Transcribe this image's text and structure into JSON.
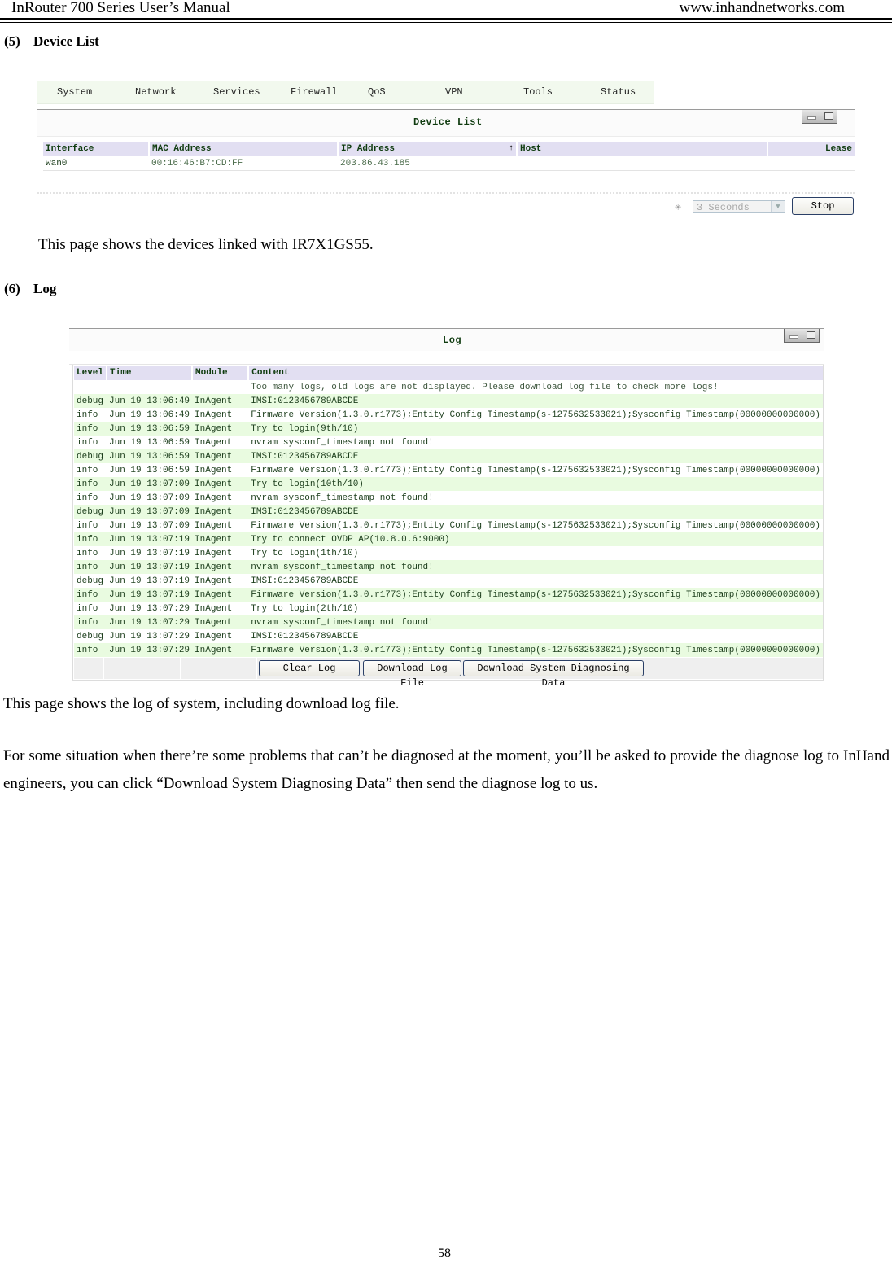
{
  "header": {
    "left": "InRouter 700 Series User’s Manual",
    "right": "www.inhandnetworks.com"
  },
  "sections": {
    "device_list": {
      "number": "(5)",
      "title": "Device List",
      "description": "This page shows the devices linked with IR7X1GS55."
    },
    "log": {
      "number": "(6)",
      "title": "Log",
      "description": "This page shows the log of system, including download log file.",
      "note": "For some situation when there’re some problems that can’t be diagnosed at the moment, you’ll be asked to provide the diagnose log to InHand engineers, you can click “Download System Diagnosing Data” then send the diagnose log to us."
    }
  },
  "device_list_ui": {
    "nav": [
      "System",
      "Network",
      "Services",
      "Firewall",
      "QoS",
      "VPN",
      "Tools",
      "Status"
    ],
    "panel_title": "Device List",
    "columns": [
      "Interface",
      "MAC Address",
      "IP Address",
      "Host",
      "Lease"
    ],
    "sort_indicator": "↑",
    "rows": [
      {
        "interface": "wan0",
        "mac": "00:16:46:B7:CD:FF",
        "ip": "203.86.43.185",
        "host": "",
        "lease": ""
      }
    ],
    "refresh_interval": "3 Seconds",
    "stop_label": "Stop",
    "spinner_glyph": "✳"
  },
  "log_ui": {
    "panel_title": "Log",
    "columns": [
      "Level",
      "Time",
      "Module",
      "Content"
    ],
    "notice": "Too many logs, old logs are not displayed. Please download log file to check more logs!",
    "rows": [
      {
        "level": "debug",
        "time": "Jun 19 13:06:49",
        "module": "InAgent",
        "content": "IMSI:0123456789ABCDE"
      },
      {
        "level": "info",
        "time": "Jun 19 13:06:49",
        "module": "InAgent",
        "content": "Firmware Version(1.3.0.r1773);Entity Config Timestamp(s-1275632533021);Sysconfig Timestamp(00000000000000)"
      },
      {
        "level": "info",
        "time": "Jun 19 13:06:59",
        "module": "InAgent",
        "content": "Try to login(9th/10)"
      },
      {
        "level": "info",
        "time": "Jun 19 13:06:59",
        "module": "InAgent",
        "content": "nvram sysconf_timestamp not found!"
      },
      {
        "level": "debug",
        "time": "Jun 19 13:06:59",
        "module": "InAgent",
        "content": "IMSI:0123456789ABCDE"
      },
      {
        "level": "info",
        "time": "Jun 19 13:06:59",
        "module": "InAgent",
        "content": "Firmware Version(1.3.0.r1773);Entity Config Timestamp(s-1275632533021);Sysconfig Timestamp(00000000000000)"
      },
      {
        "level": "info",
        "time": "Jun 19 13:07:09",
        "module": "InAgent",
        "content": "Try to login(10th/10)"
      },
      {
        "level": "info",
        "time": "Jun 19 13:07:09",
        "module": "InAgent",
        "content": "nvram sysconf_timestamp not found!"
      },
      {
        "level": "debug",
        "time": "Jun 19 13:07:09",
        "module": "InAgent",
        "content": "IMSI:0123456789ABCDE"
      },
      {
        "level": "info",
        "time": "Jun 19 13:07:09",
        "module": "InAgent",
        "content": "Firmware Version(1.3.0.r1773);Entity Config Timestamp(s-1275632533021);Sysconfig Timestamp(00000000000000)"
      },
      {
        "level": "info",
        "time": "Jun 19 13:07:19",
        "module": "InAgent",
        "content": "Try to connect OVDP AP(10.8.0.6:9000)"
      },
      {
        "level": "info",
        "time": "Jun 19 13:07:19",
        "module": "InAgent",
        "content": "Try to login(1th/10)"
      },
      {
        "level": "info",
        "time": "Jun 19 13:07:19",
        "module": "InAgent",
        "content": "nvram sysconf_timestamp not found!"
      },
      {
        "level": "debug",
        "time": "Jun 19 13:07:19",
        "module": "InAgent",
        "content": "IMSI:0123456789ABCDE"
      },
      {
        "level": "info",
        "time": "Jun 19 13:07:19",
        "module": "InAgent",
        "content": "Firmware Version(1.3.0.r1773);Entity Config Timestamp(s-1275632533021);Sysconfig Timestamp(00000000000000)"
      },
      {
        "level": "info",
        "time": "Jun 19 13:07:29",
        "module": "InAgent",
        "content": "Try to login(2th/10)"
      },
      {
        "level": "info",
        "time": "Jun 19 13:07:29",
        "module": "InAgent",
        "content": "nvram sysconf_timestamp not found!"
      },
      {
        "level": "debug",
        "time": "Jun 19 13:07:29",
        "module": "InAgent",
        "content": "IMSI:0123456789ABCDE"
      },
      {
        "level": "info",
        "time": "Jun 19 13:07:29",
        "module": "InAgent",
        "content": "Firmware Version(1.3.0.r1773);Entity Config Timestamp(s-1275632533021);Sysconfig Timestamp(00000000000000)"
      }
    ],
    "buttons": {
      "clear": "Clear Log",
      "download_log": "Download Log File",
      "download_diag": "Download System Diagnosing Data"
    }
  },
  "colors": {
    "header_text": "#0f3b0f",
    "table_header_bg": "#e2dff2",
    "alt_row_bg": "#e9fbe0",
    "nav_bg": "#f2f9ee",
    "button_border": "#2a3f66"
  },
  "page_number": "58"
}
